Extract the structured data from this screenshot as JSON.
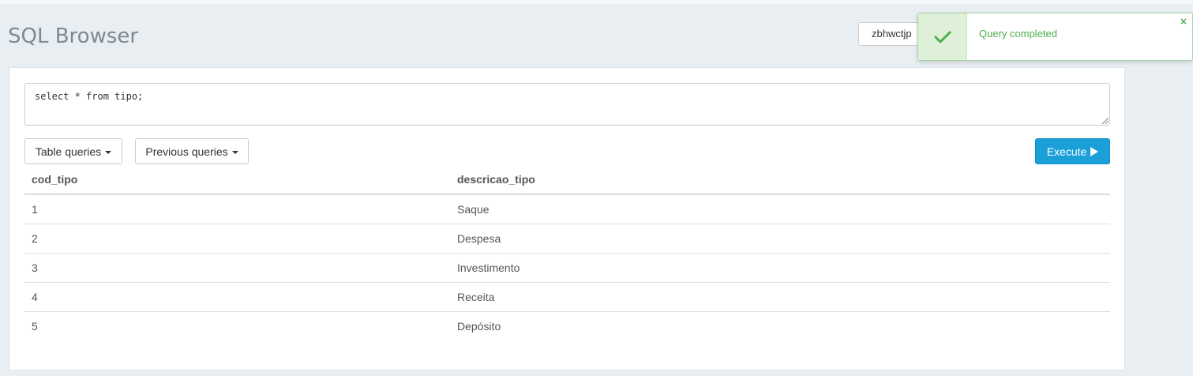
{
  "header": {
    "title": "SQL Browser",
    "database_selector_value": "zbhwctjp"
  },
  "editor": {
    "query": "select * from tipo;"
  },
  "toolbar": {
    "table_queries_label": "Table queries",
    "previous_queries_label": "Previous queries",
    "execute_label": "Execute"
  },
  "results": {
    "columns": [
      "cod_tipo",
      "descricao_tipo"
    ],
    "rows": [
      [
        "1",
        "Saque"
      ],
      [
        "2",
        "Despesa"
      ],
      [
        "3",
        "Investimento"
      ],
      [
        "4",
        "Receita"
      ],
      [
        "5",
        "Depósito"
      ]
    ]
  },
  "notification": {
    "message": "Query completed",
    "icon": "check-icon",
    "close_label": "×",
    "color": "#4cae4c"
  },
  "colors": {
    "accent": "#1a9fd9",
    "success": "#4cae4c"
  }
}
